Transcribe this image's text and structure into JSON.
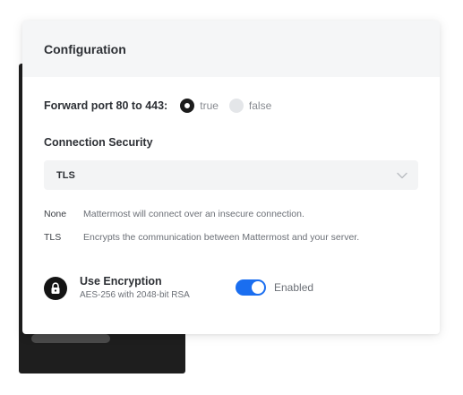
{
  "card": {
    "title": "Configuration"
  },
  "forward_port": {
    "label": "Forward port 80 to 443:",
    "options": [
      {
        "label": "true",
        "selected": true
      },
      {
        "label": "false",
        "selected": false
      }
    ]
  },
  "connection_security": {
    "label": "Connection Security",
    "selected_value": "TLS",
    "icon": "chevron-down-icon",
    "descriptions": [
      {
        "key": "None",
        "text": "Mattermost will connect over an insecure connection."
      },
      {
        "key": "TLS",
        "text": "Encrypts the communication between Mattermost and your server."
      }
    ]
  },
  "encryption": {
    "icon": "lock-icon",
    "title": "Use Encryption",
    "subtitle": "AES-256 with 2048-bit RSA",
    "toggle_on": true,
    "toggle_label": "Enabled"
  },
  "colors": {
    "accent": "#1a6ef0",
    "header_bg": "#f5f6f7",
    "dark_panel": "#1e1e1e"
  }
}
